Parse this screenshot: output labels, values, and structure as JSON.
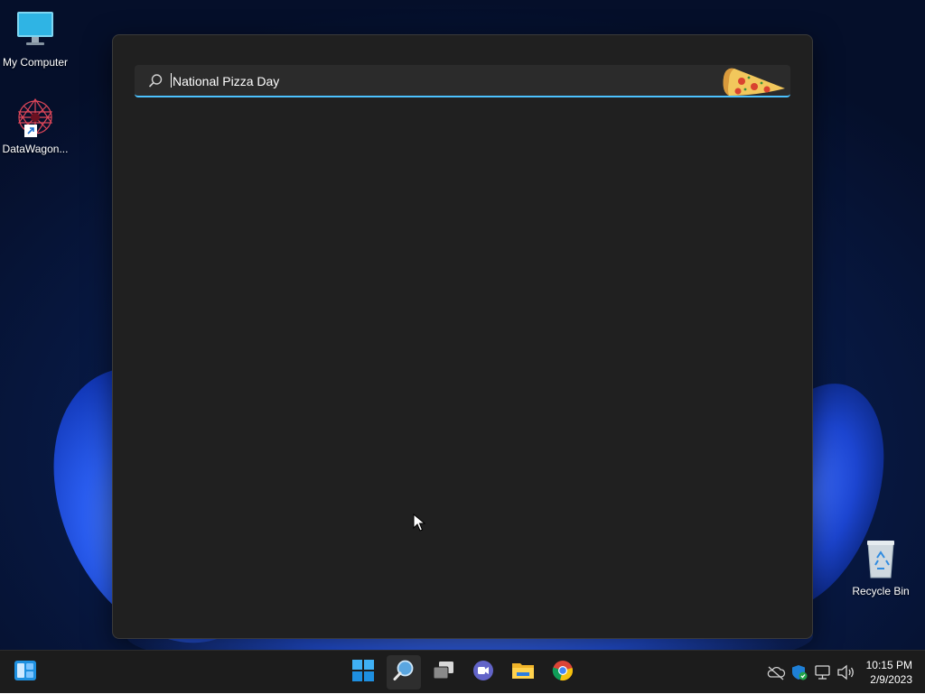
{
  "desktop": {
    "icons": [
      {
        "label": "My Computer",
        "icon": "monitor-icon"
      },
      {
        "label": "DataWagon...",
        "icon": "datawagon-app-icon"
      },
      {
        "label": "Recycle Bin",
        "icon": "recycle-bin-icon"
      }
    ]
  },
  "search": {
    "value": "National Pizza Day",
    "icon": "search-icon",
    "highlight_icon": "pizza-slice-icon",
    "accent_color": "#4cc2ff"
  },
  "taskbar": {
    "left": [
      {
        "icon": "widgets-icon"
      }
    ],
    "center": [
      {
        "icon": "windows-start-icon"
      },
      {
        "icon": "search-icon",
        "active": true
      },
      {
        "icon": "task-view-icon"
      },
      {
        "icon": "teams-chat-icon"
      },
      {
        "icon": "file-explorer-icon"
      },
      {
        "icon": "chrome-icon"
      }
    ],
    "tray": [
      {
        "icon": "onedrive-offline-icon"
      },
      {
        "icon": "windows-security-icon"
      },
      {
        "icon": "network-icon"
      },
      {
        "icon": "volume-icon"
      }
    ],
    "clock": {
      "time": "10:15 PM",
      "date": "2/9/2023"
    }
  }
}
